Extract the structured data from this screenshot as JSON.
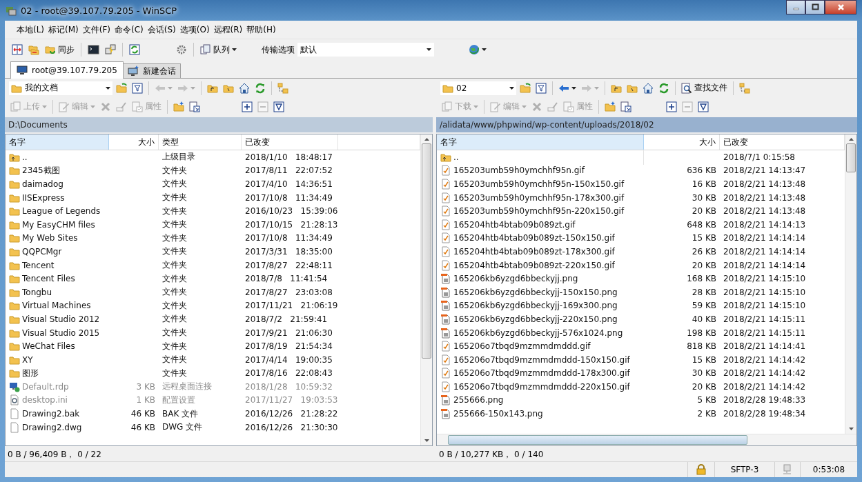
{
  "window": {
    "title": "02 - root@39.107.79.205 - WinSCP"
  },
  "menu": [
    "本地(L)",
    "标记(M)",
    "文件(F)",
    "命令(C)",
    "会话(S)",
    "选项(O)",
    "远程(R)",
    "帮助(H)"
  ],
  "toolbar": {
    "sync_label": "同步",
    "queue_label": "队列",
    "transfer_label": "传输选项",
    "transfer_value": "默认"
  },
  "tabs": [
    {
      "label": "root@39.107.79.205",
      "selected": true
    },
    {
      "label": "新建会话",
      "selected": false
    }
  ],
  "left": {
    "active": false,
    "location": "我的文档",
    "back_disabled": true,
    "forward_disabled": true,
    "actions": [
      {
        "label": "上传",
        "disabled": true
      },
      {
        "label": "编辑",
        "disabled": true
      },
      {
        "label": "属性",
        "disabled": true
      }
    ],
    "path": "D:\\Documents",
    "columns": [
      "名字",
      "大小",
      "类型",
      "已改变"
    ],
    "rows": [
      {
        "kind": "parent",
        "name": "..",
        "size": "",
        "type": "上级目录",
        "modified": "2018/1/10   18:48:17",
        "hidden": false
      },
      {
        "kind": "folder",
        "name": "2345截图",
        "size": "",
        "type": "文件夹",
        "modified": "2017/8/11   22:07:52",
        "hidden": false
      },
      {
        "kind": "folder",
        "name": "daimadog",
        "size": "",
        "type": "文件夹",
        "modified": "2017/4/10   14:36:51",
        "hidden": false
      },
      {
        "kind": "folder",
        "name": "IISExpress",
        "size": "",
        "type": "文件夹",
        "modified": "2017/10/8   11:34:49",
        "hidden": false
      },
      {
        "kind": "folder",
        "name": "League of Legends",
        "size": "",
        "type": "文件夹",
        "modified": "2016/10/23   15:39:06",
        "hidden": false
      },
      {
        "kind": "folder",
        "name": "My EasyCHM files",
        "size": "",
        "type": "文件夹",
        "modified": "2017/10/15   21:28:13",
        "hidden": false
      },
      {
        "kind": "folder",
        "name": "My Web Sites",
        "size": "",
        "type": "文件夹",
        "modified": "2017/10/8   11:34:49",
        "hidden": false
      },
      {
        "kind": "folder",
        "name": "QQPCMgr",
        "size": "",
        "type": "文件夹",
        "modified": "2017/3/31   18:35:00",
        "hidden": false
      },
      {
        "kind": "folder",
        "name": "Tencent",
        "size": "",
        "type": "文件夹",
        "modified": "2017/8/27   22:48:11",
        "hidden": false
      },
      {
        "kind": "folder",
        "name": "Tencent Files",
        "size": "",
        "type": "文件夹",
        "modified": "2018/7/8   11:41:54",
        "hidden": false
      },
      {
        "kind": "folder",
        "name": "Tongbu",
        "size": "",
        "type": "文件夹",
        "modified": "2017/8/27   23:03:08",
        "hidden": false
      },
      {
        "kind": "folder",
        "name": "Virtual Machines",
        "size": "",
        "type": "文件夹",
        "modified": "2017/11/21   21:06:19",
        "hidden": false
      },
      {
        "kind": "folder",
        "name": "Visual Studio 2012",
        "size": "",
        "type": "文件夹",
        "modified": "2018/7/2   21:59:41",
        "hidden": false
      },
      {
        "kind": "folder",
        "name": "Visual Studio 2015",
        "size": "",
        "type": "文件夹",
        "modified": "2017/9/21   21:06:30",
        "hidden": false
      },
      {
        "kind": "folder",
        "name": "WeChat Files",
        "size": "",
        "type": "文件夹",
        "modified": "2017/8/19   21:54:34",
        "hidden": false
      },
      {
        "kind": "folder",
        "name": "XY",
        "size": "",
        "type": "文件夹",
        "modified": "2017/4/14   19:00:35",
        "hidden": false
      },
      {
        "kind": "folder",
        "name": "图形",
        "size": "",
        "type": "文件夹",
        "modified": "2017/8/16   22:08:43",
        "hidden": false
      },
      {
        "kind": "rdp",
        "name": "Default.rdp",
        "size": "3 KB",
        "type": "远程桌面连接",
        "modified": "2018/1/28   10:59:32",
        "hidden": true
      },
      {
        "kind": "ini",
        "name": "desktop.ini",
        "size": "1 KB",
        "type": "配置设置",
        "modified": "2017/11/27   19:03:53",
        "hidden": true
      },
      {
        "kind": "file",
        "name": "Drawing2.bak",
        "size": "46 KB",
        "type": "BAK 文件",
        "modified": "2016/12/26   21:28:22",
        "hidden": false
      },
      {
        "kind": "file",
        "name": "Drawing2.dwg",
        "size": "46 KB",
        "type": "DWG 文件",
        "modified": "2016/12/26   21:30:30",
        "hidden": false
      }
    ],
    "status": "0 B / 96,409 B， 0 / 22"
  },
  "right": {
    "active": true,
    "location": "02",
    "back_disabled": false,
    "forward_disabled": true,
    "find_label": "查找文件",
    "actions": [
      {
        "label": "下载",
        "disabled": true
      },
      {
        "label": "编辑",
        "disabled": true
      },
      {
        "label": "属性",
        "disabled": true
      }
    ],
    "path": "/alidata/www/phpwind/wp-content/uploads/2018/02",
    "columns": [
      "名字",
      "大小",
      "已改变"
    ],
    "rows": [
      {
        "kind": "parent",
        "name": "..",
        "size": "",
        "modified": "2018/7/1 0:15:58"
      },
      {
        "kind": "gif",
        "name": "165203umb59h0ymchhf95n.gif",
        "size": "636 KB",
        "modified": "2018/2/21 14:13:47"
      },
      {
        "kind": "gif",
        "name": "165203umb59h0ymchhf95n-150x150.gif",
        "size": "16 KB",
        "modified": "2018/2/21 14:13:48"
      },
      {
        "kind": "gif",
        "name": "165203umb59h0ymchhf95n-178x300.gif",
        "size": "30 KB",
        "modified": "2018/2/21 14:13:48"
      },
      {
        "kind": "gif",
        "name": "165203umb59h0ymchhf95n-220x150.gif",
        "size": "20 KB",
        "modified": "2018/2/21 14:13:48"
      },
      {
        "kind": "gif",
        "name": "165204htb4btab09b089zt.gif",
        "size": "648 KB",
        "modified": "2018/2/21 14:14:13"
      },
      {
        "kind": "gif",
        "name": "165204htb4btab09b089zt-150x150.gif",
        "size": "15 KB",
        "modified": "2018/2/21 14:14:14"
      },
      {
        "kind": "gif",
        "name": "165204htb4btab09b089zt-178x300.gif",
        "size": "26 KB",
        "modified": "2018/2/21 14:14:14"
      },
      {
        "kind": "gif",
        "name": "165204htb4btab09b089zt-220x150.gif",
        "size": "20 KB",
        "modified": "2018/2/21 14:14:14"
      },
      {
        "kind": "png",
        "name": "165206kb6yzgd6bbeckyjj.png",
        "size": "168 KB",
        "modified": "2018/2/21 14:15:10"
      },
      {
        "kind": "png",
        "name": "165206kb6yzgd6bbeckyjj-150x150.png",
        "size": "28 KB",
        "modified": "2018/2/21 14:15:10"
      },
      {
        "kind": "png",
        "name": "165206kb6yzgd6bbeckyjj-169x300.png",
        "size": "59 KB",
        "modified": "2018/2/21 14:15:10"
      },
      {
        "kind": "png",
        "name": "165206kb6yzgd6bbeckyjj-220x150.png",
        "size": "40 KB",
        "modified": "2018/2/21 14:15:11"
      },
      {
        "kind": "png",
        "name": "165206kb6yzgd6bbeckyjj-576x1024.png",
        "size": "198 KB",
        "modified": "2018/2/21 14:15:11"
      },
      {
        "kind": "gif",
        "name": "165206o7tbqd9mzmmdmddd.gif",
        "size": "818 KB",
        "modified": "2018/2/21 14:14:41"
      },
      {
        "kind": "gif",
        "name": "165206o7tbqd9mzmmdmddd-150x150.gif",
        "size": "15 KB",
        "modified": "2018/2/21 14:14:42"
      },
      {
        "kind": "gif",
        "name": "165206o7tbqd9mzmmdmddd-178x300.gif",
        "size": "30 KB",
        "modified": "2018/2/21 14:14:42"
      },
      {
        "kind": "gif",
        "name": "165206o7tbqd9mzmmdmddd-220x150.gif",
        "size": "20 KB",
        "modified": "2018/2/21 14:14:42"
      },
      {
        "kind": "png",
        "name": "255666.png",
        "size": "5 KB",
        "modified": "2018/2/28 19:48:33"
      },
      {
        "kind": "png",
        "name": "255666-150x143.png",
        "size": "2 KB",
        "modified": "2018/2/28 19:48:34"
      }
    ],
    "status": "0 B / 10,277 KB， 0 / 140"
  },
  "statusbar": {
    "protocol": "SFTP-3",
    "elapsed": "0:53:08"
  }
}
